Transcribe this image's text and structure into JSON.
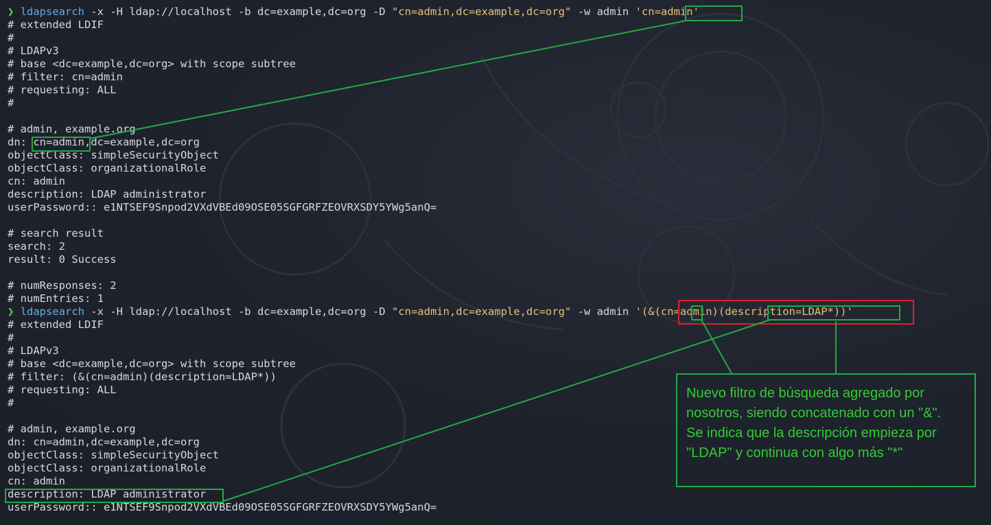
{
  "terminal": {
    "prompt_symbol": "❯",
    "line1": {
      "cmd": "ldapsearch",
      "args": " -x -H ldap://localhost -b dc=example,dc=org -D ",
      "bind_dn": "\"cn=admin,dc=example,dc=org\"",
      "pw": " -w admin ",
      "filter": "'cn=admin'"
    },
    "block1": [
      "# extended LDIF",
      "#",
      "# LDAPv3",
      "# base <dc=example,dc=org> with scope subtree",
      "# filter: cn=admin",
      "# requesting: ALL",
      "#",
      "",
      "# admin, example.org",
      "dn: cn=admin,dc=example,dc=org",
      "objectClass: simpleSecurityObject",
      "objectClass: organizationalRole",
      "cn: admin",
      "description: LDAP administrator",
      "userPassword:: e1NTSEF9Snpod2VXdVBEd09OSE05SGFGRFZEOVRXSDY5YWg5anQ=",
      "",
      "# search result",
      "search: 2",
      "result: 0 Success",
      "",
      "# numResponses: 2",
      "# numEntries: 1"
    ],
    "line2": {
      "cmd": "ldapsearch",
      "args": " -x -H ldap://localhost -b dc=example,dc=org -D ",
      "bind_dn": "\"cn=admin,dc=example,dc=org\"",
      "pw": " -w admin ",
      "filter": "'(&(cn=admin)(description=LDAP*))'"
    },
    "block2": [
      "# extended LDIF",
      "#",
      "# LDAPv3",
      "# base <dc=example,dc=org> with scope subtree",
      "# filter: (&(cn=admin)(description=LDAP*))",
      "# requesting: ALL",
      "#",
      "",
      "# admin, example.org",
      "dn: cn=admin,dc=example,dc=org",
      "objectClass: simpleSecurityObject",
      "objectClass: organizationalRole",
      "cn: admin",
      "description: LDAP administrator",
      "userPassword:: e1NTSEF9Snpod2VXdVBEd09OSE05SGFGRFZEOVRXSDY5YWg5anQ="
    ]
  },
  "callout": {
    "para1": "Nuevo filtro de búsqueda agregado por nosotros, siendo concatenado con un \"&\".",
    "para2": "Se indica que la descripción empieza por \"LDAP\" y continua con algo más \"*\""
  },
  "colors": {
    "background": "#1f232d",
    "text": "#d7dae0",
    "prompt": "#5fd75f",
    "command": "#64b0e0",
    "string": "#e6c07b",
    "annotation_green": "#22aa44",
    "annotation_red": "#e0202a",
    "callout_text": "#33cc33"
  }
}
